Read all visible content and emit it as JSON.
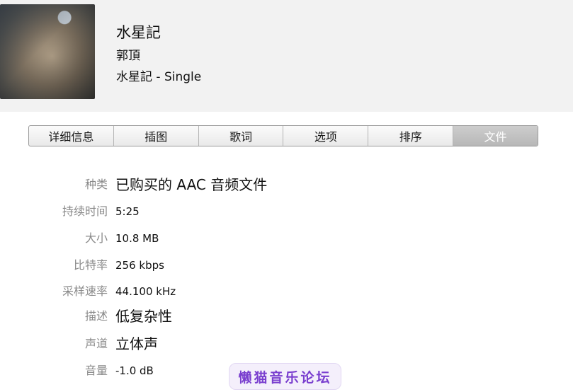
{
  "header": {
    "title": "水星記",
    "artist": "郭頂",
    "album": "水星記 - Single"
  },
  "tabs": [
    {
      "label": "详细信息",
      "active": false
    },
    {
      "label": "插图",
      "active": false
    },
    {
      "label": "歌词",
      "active": false
    },
    {
      "label": "选项",
      "active": false
    },
    {
      "label": "排序",
      "active": false
    },
    {
      "label": "文件",
      "active": true
    }
  ],
  "file_info": [
    {
      "label": "种类",
      "value": "已购买的 AAC 音频文件"
    },
    {
      "label": "持续时间",
      "value": "5:25"
    },
    {
      "label": "大小",
      "value": "10.8 MB"
    },
    {
      "label": "比特率",
      "value": "256 kbps"
    },
    {
      "label": "采样速率",
      "value": "44.100 kHz"
    },
    {
      "label": "描述",
      "value": "低复杂性"
    },
    {
      "label": "声道",
      "value": "立体声"
    },
    {
      "label": "音量",
      "value": "-1.0 dB"
    }
  ],
  "watermark": {
    "text": "懒猫音乐论坛"
  },
  "colors": {
    "header_bg": "#f2f2f2",
    "label_gray": "#8a8a8a",
    "active_tab": "#bfbfbf",
    "watermark_purple": "#7a3fcf"
  }
}
